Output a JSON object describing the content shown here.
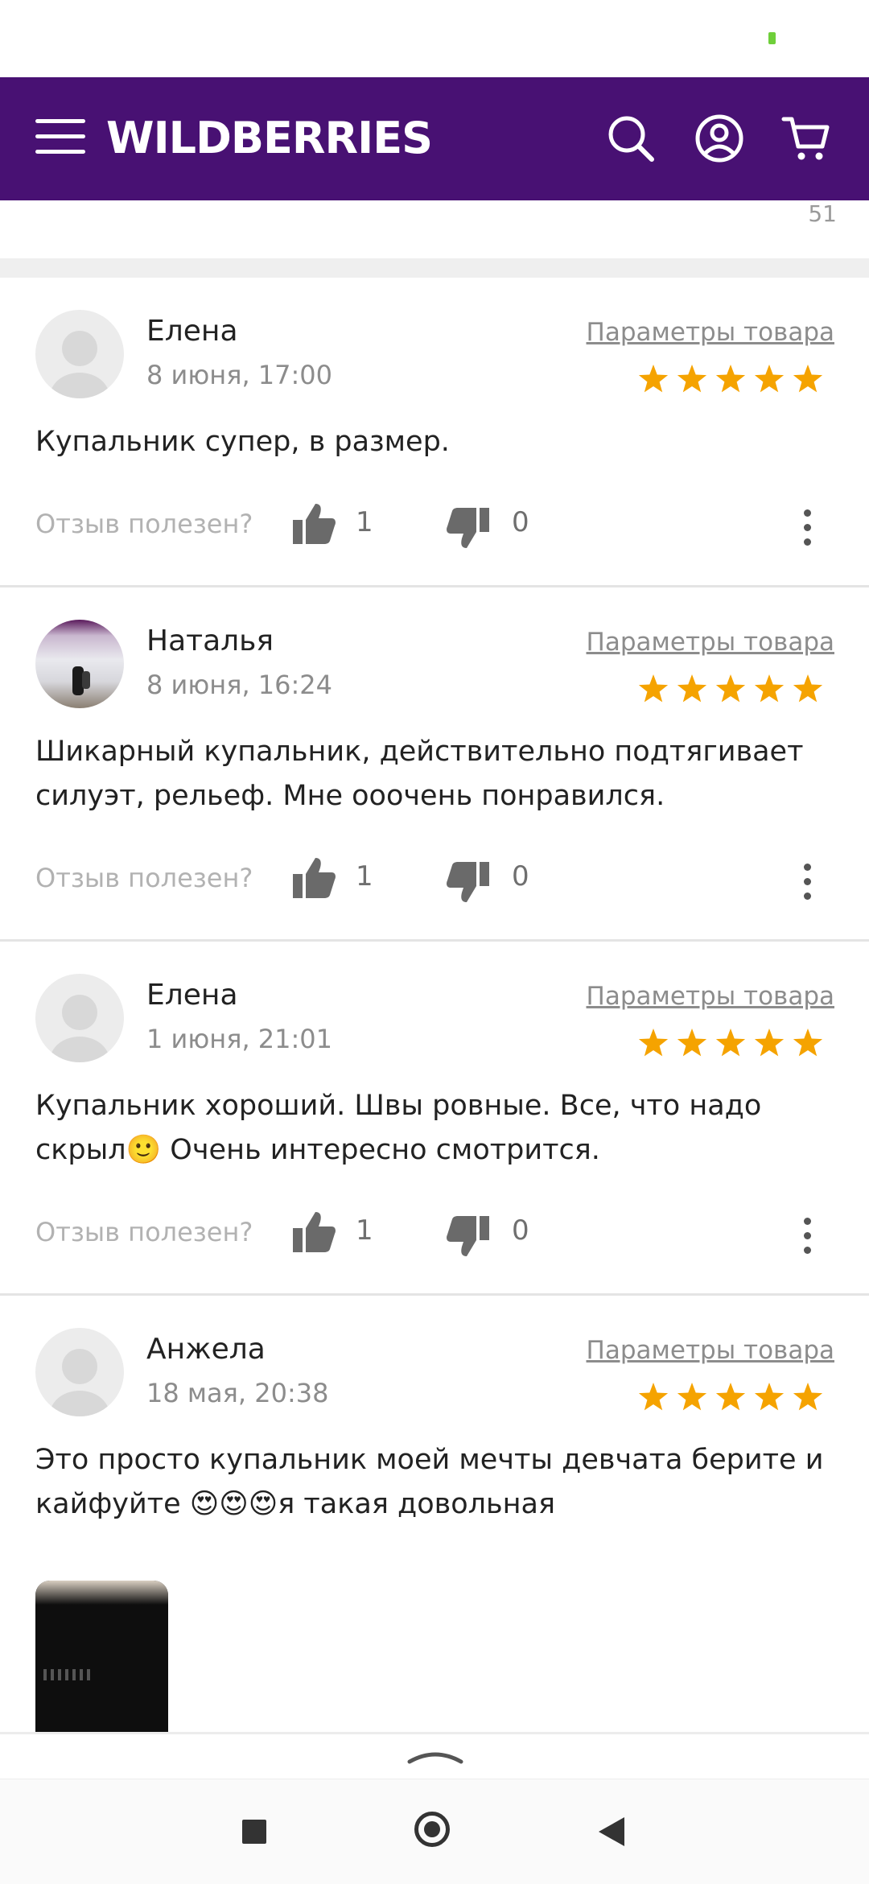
{
  "header": {
    "brand": "WILDBERRIES",
    "icons": [
      "menu-icon",
      "search-icon",
      "profile-icon",
      "cart-icon"
    ],
    "background": "#481173"
  },
  "previous_review": {
    "partial_number": "51"
  },
  "reviews": [
    {
      "name": "Елена",
      "date": "8 июня, 17:00",
      "params_link": "Параметры товара",
      "rating": 5,
      "text": "Купальник супер, в размер.",
      "useful_label": "Отзыв полезен?",
      "likes": "1",
      "dislikes": "0",
      "avatar": "placeholder"
    },
    {
      "name": "Наталья",
      "date": "8 июня, 16:24",
      "params_link": "Параметры товара",
      "rating": 5,
      "text": "Шикарный купальник, действительно подтягивает силуэт, рельеф. Мне ооочень понравился.",
      "useful_label": "Отзыв полезен?",
      "likes": "1",
      "dislikes": "0",
      "avatar": "photo"
    },
    {
      "name": "Елена",
      "date": "1 июня, 21:01",
      "params_link": "Параметры товара",
      "rating": 5,
      "text": "Купальник хороший. Швы ровные. Все, что надо скрыл🙂 Очень интересно смотрится.",
      "useful_label": "Отзыв полезен?",
      "likes": "1",
      "dislikes": "0",
      "avatar": "placeholder"
    },
    {
      "name": "Анжела",
      "date": "18 мая, 20:38",
      "params_link": "Параметры товара",
      "rating": 5,
      "text": "Это просто купальник моей мечты девчата берите и кайфуйте 😍😍😍я такая довольная",
      "avatar": "placeholder",
      "has_photo": true
    }
  ],
  "colors": {
    "star": "#f5a300",
    "muted": "#8c8c8c",
    "purple": "#481173"
  },
  "system_nav": [
    "recents-button",
    "home-button",
    "back-button"
  ]
}
